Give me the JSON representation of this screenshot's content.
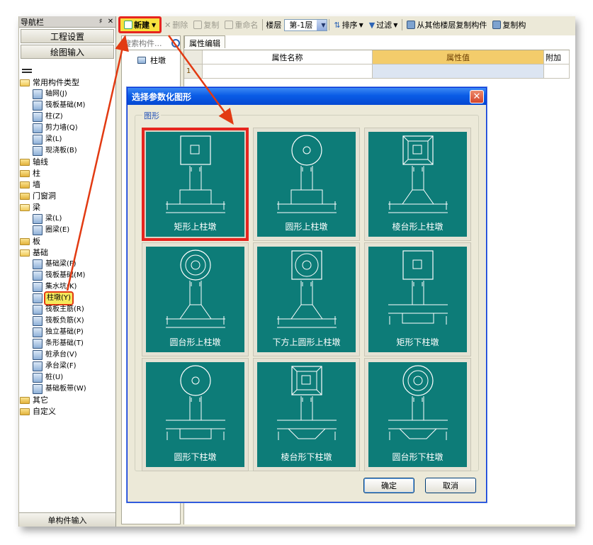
{
  "nav": {
    "title": "导航栏",
    "pin": "♯",
    "close": "✕",
    "buttons": [
      "工程设置",
      "绘图输入"
    ],
    "bottom": "单构件输入",
    "tree": [
      {
        "level": 0,
        "type": "folder",
        "open": true,
        "label": "常用构件类型"
      },
      {
        "level": 1,
        "type": "item",
        "label": "轴网(J)"
      },
      {
        "level": 1,
        "type": "item",
        "label": "筏板基础(M)"
      },
      {
        "level": 1,
        "type": "item",
        "label": "柱(Z)"
      },
      {
        "level": 1,
        "type": "item",
        "label": "剪力墙(Q)"
      },
      {
        "level": 1,
        "type": "item",
        "label": "梁(L)"
      },
      {
        "level": 1,
        "type": "item",
        "label": "现浇板(B)"
      },
      {
        "level": 0,
        "type": "folder",
        "open": false,
        "label": "轴线"
      },
      {
        "level": 0,
        "type": "folder",
        "open": false,
        "label": "柱"
      },
      {
        "level": 0,
        "type": "folder",
        "open": false,
        "label": "墙"
      },
      {
        "level": 0,
        "type": "folder",
        "open": false,
        "label": "门窗洞"
      },
      {
        "level": 0,
        "type": "folder",
        "open": true,
        "label": "梁"
      },
      {
        "level": 1,
        "type": "item",
        "label": "梁(L)"
      },
      {
        "level": 1,
        "type": "item",
        "label": "圈梁(E)"
      },
      {
        "level": 0,
        "type": "folder",
        "open": false,
        "label": "板"
      },
      {
        "level": 0,
        "type": "folder",
        "open": true,
        "label": "基础"
      },
      {
        "level": 1,
        "type": "item",
        "label": "基础梁(F)"
      },
      {
        "level": 1,
        "type": "item",
        "label": "筏板基础(M)"
      },
      {
        "level": 1,
        "type": "item",
        "label": "集水坑(K)"
      },
      {
        "level": 1,
        "type": "item",
        "label": "柱墩(Y)",
        "selected": true
      },
      {
        "level": 1,
        "type": "item",
        "label": "筏板主筋(R)"
      },
      {
        "level": 1,
        "type": "item",
        "label": "筏板负筋(X)"
      },
      {
        "level": 1,
        "type": "item",
        "label": "独立基础(P)"
      },
      {
        "level": 1,
        "type": "item",
        "label": "条形基础(T)"
      },
      {
        "level": 1,
        "type": "item",
        "label": "桩承台(V)"
      },
      {
        "level": 1,
        "type": "item",
        "label": "承台梁(F)"
      },
      {
        "level": 1,
        "type": "item",
        "label": "桩(U)"
      },
      {
        "level": 1,
        "type": "item",
        "label": "基础板带(W)"
      },
      {
        "level": 0,
        "type": "folder",
        "open": false,
        "label": "其它"
      },
      {
        "level": 0,
        "type": "folder",
        "open": false,
        "label": "自定义"
      }
    ]
  },
  "toolbar": {
    "new": "新建",
    "delete": "删除",
    "copy": "复制",
    "rename": "重命名",
    "floor_label": "楼层",
    "floor_value": "第-1层",
    "sort": "排序",
    "filter": "过滤",
    "copy_from_floor": "从其他楼层复制构件",
    "copy_more": "复制构"
  },
  "search": {
    "placeholder": "搜索构件...",
    "item": "柱墩"
  },
  "property": {
    "tab": "属性编辑",
    "col_name": "属性名称",
    "col_value": "属性值",
    "col_extra": "附加",
    "row_number": "1"
  },
  "dialog": {
    "title": "选择参数化图形",
    "close": "✕",
    "group_label": "图形",
    "shapes": [
      {
        "label": "矩形上柱墩",
        "top": "square",
        "stem": "rect",
        "selected": true
      },
      {
        "label": "圆形上柱墩",
        "top": "circle",
        "stem": "rect",
        "selected": false
      },
      {
        "label": "棱台形上柱墩",
        "top": "frustum",
        "stem": "trap",
        "selected": false
      },
      {
        "label": "圆台形上柱墩",
        "top": "ring",
        "stem": "trap",
        "selected": false
      },
      {
        "label": "下方上圆形上柱墩",
        "top": "squarecircle",
        "stem": "trap",
        "selected": false
      },
      {
        "label": "矩形下柱墩",
        "top": "square",
        "stem": "below_rect",
        "selected": false
      },
      {
        "label": "圆形下柱墩",
        "top": "circle",
        "stem": "below_rect",
        "selected": false
      },
      {
        "label": "棱台形下柱墩",
        "top": "frustum",
        "stem": "below_trap",
        "selected": false
      },
      {
        "label": "圆台形下柱墩",
        "top": "ring",
        "stem": "below_trap",
        "selected": false
      }
    ],
    "ok": "确定",
    "cancel": "取消"
  },
  "colors": {
    "accent_red": "#e6251f",
    "highlight_yellow": "#f7e13f",
    "shape_bg": "#0d7c78",
    "title_blue": "#0a5ce6"
  }
}
